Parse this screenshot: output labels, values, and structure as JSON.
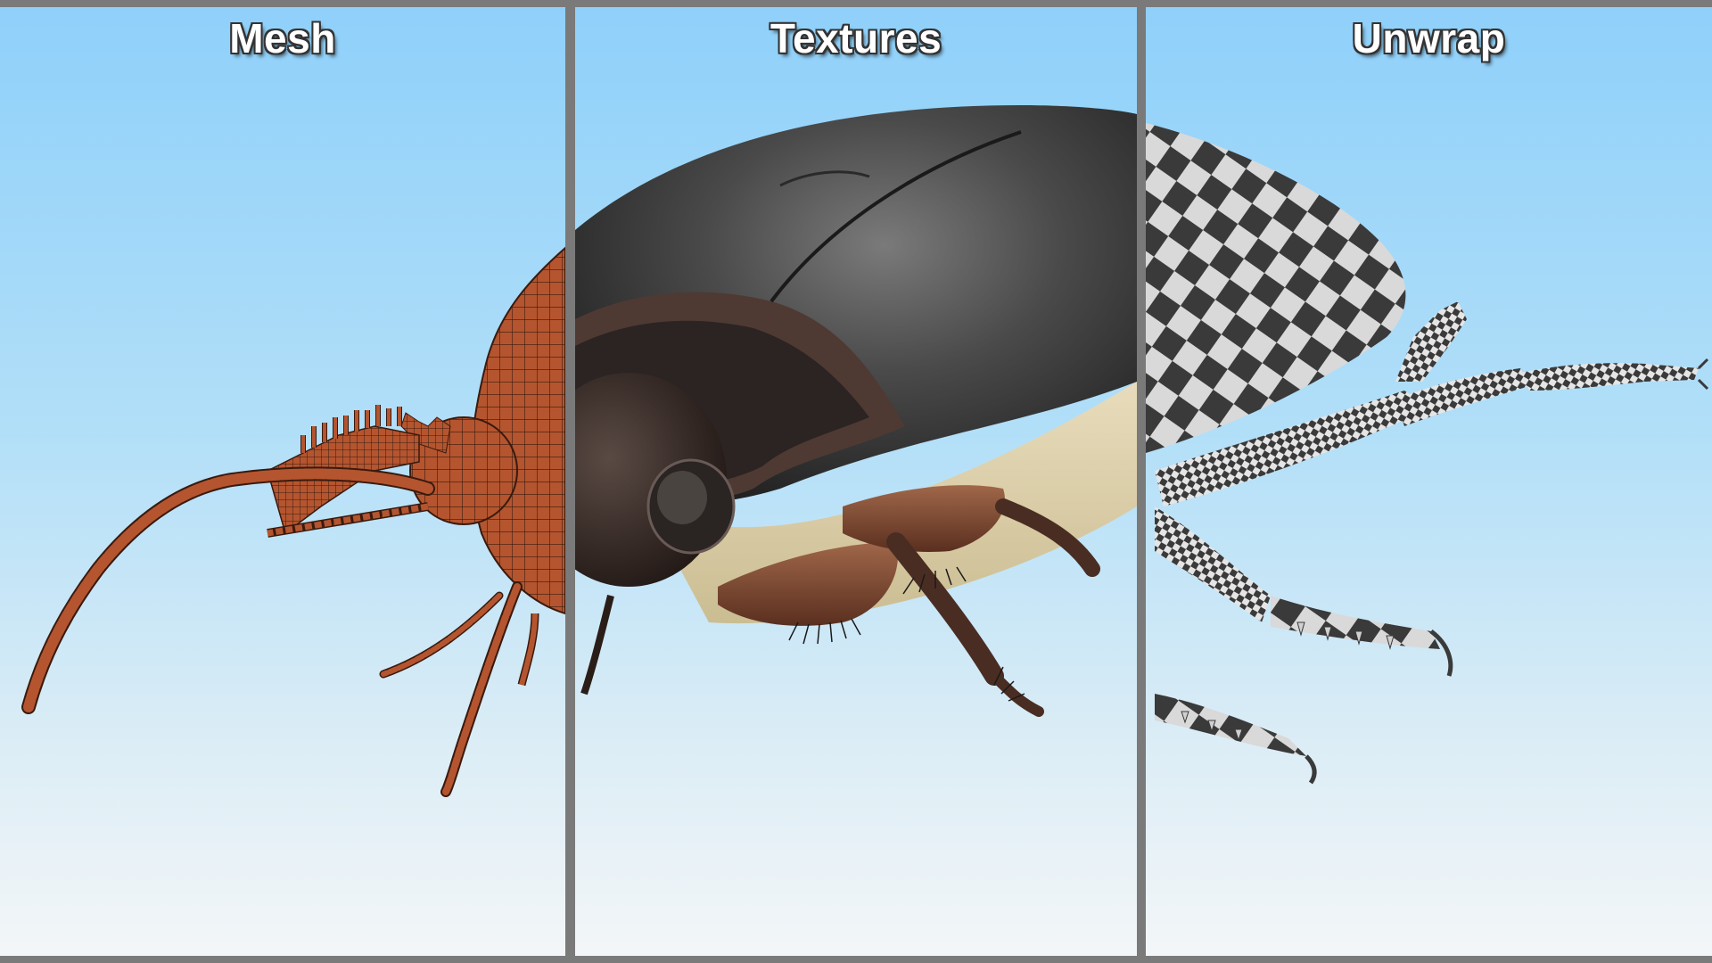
{
  "panels": [
    {
      "title": "Mesh"
    },
    {
      "title": "Textures"
    },
    {
      "title": "Unwrap"
    }
  ],
  "colors": {
    "mesh": "#b4552f",
    "frame": "#7a7a7a",
    "sky_top": "#8fd0fa",
    "sky_bottom": "#f3f6f8"
  }
}
